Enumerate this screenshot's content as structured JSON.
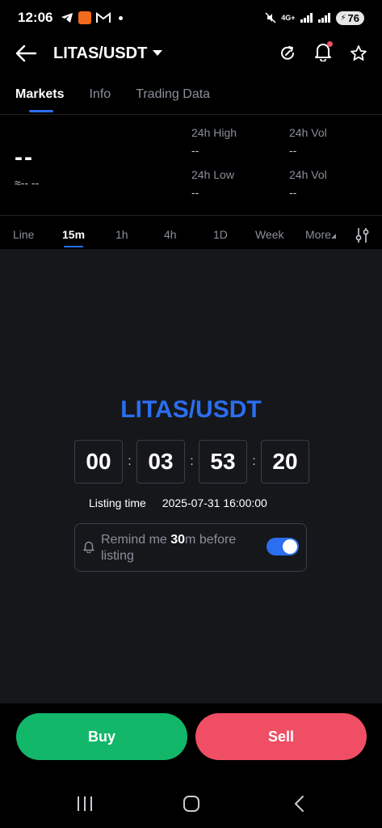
{
  "status_bar": {
    "time": "12:06",
    "network": "4G+",
    "battery": "76"
  },
  "header": {
    "pair": "LITAS/USDT"
  },
  "tabs": [
    {
      "label": "Markets"
    },
    {
      "label": "Info"
    },
    {
      "label": "Trading Data"
    }
  ],
  "stats": {
    "price": "--",
    "price_sub": "≈-- --",
    "high_label": "24h High",
    "high_value": "--",
    "vol1_label": "24h Vol",
    "vol1_value": "--",
    "low_label": "24h Low",
    "low_value": "--",
    "vol2_label": "24h Vol",
    "vol2_value": "--"
  },
  "intervals": [
    {
      "label": "Line"
    },
    {
      "label": "15m"
    },
    {
      "label": "1h"
    },
    {
      "label": "4h"
    },
    {
      "label": "1D"
    },
    {
      "label": "Week"
    },
    {
      "label": "More"
    }
  ],
  "listing": {
    "pair": "LITAS/USDT",
    "countdown": [
      "00",
      "03",
      "53",
      "20"
    ],
    "time_label": "Listing time",
    "time_value": "2025-07-31 16:00:00",
    "remind_prefix": "Remind me ",
    "remind_minutes": "30",
    "remind_suffix": "m before listing",
    "remind_enabled": true
  },
  "actions": {
    "buy": "Buy",
    "sell": "Sell"
  },
  "colors": {
    "accent": "#2b6ef0",
    "buy": "#12b76a",
    "sell": "#f04e64",
    "panel": "#15171b"
  }
}
